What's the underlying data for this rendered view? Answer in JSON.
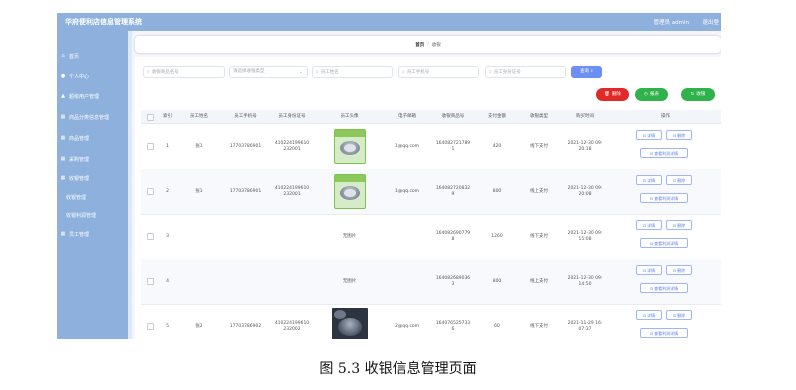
{
  "app": {
    "title": "华府便利店信息管理系统",
    "admin": "管理员 admin",
    "logout": "退出登"
  },
  "sidebar": {
    "items": [
      {
        "label": "首页",
        "icon": "home-icon"
      },
      {
        "label": "个人中心",
        "icon": "user-icon"
      },
      {
        "label": "超级用户管理",
        "icon": "user-admin-icon"
      },
      {
        "label": "商品分类信息管理",
        "icon": "grid-icon"
      },
      {
        "label": "商品管理",
        "icon": "grid-icon"
      },
      {
        "label": "采购管理",
        "icon": "grid-icon"
      },
      {
        "label": "收银管理",
        "icon": "grid-icon"
      },
      {
        "label": "收银管理",
        "sub": true
      },
      {
        "label": "收银利润管理",
        "sub": true
      },
      {
        "label": "员工管理",
        "icon": "grid-icon"
      }
    ]
  },
  "breadcrumb": {
    "home": "首页",
    "current": "收银"
  },
  "filters": {
    "order_no": "收银商品名号",
    "pay_type": "请选择收银类型",
    "emp_name": "员工姓名",
    "emp_phone": "员工手机号",
    "emp_id": "员工身份证号",
    "search": "查询"
  },
  "actions": {
    "delete": "删除",
    "report": "报表",
    "stats": "收银"
  },
  "table": {
    "headers": [
      "索引",
      "员工姓名",
      "员工手机号",
      "员工身份证号",
      "员工头像",
      "电子邮箱",
      "收银商品号",
      "支付金额",
      "收银类型",
      "购买时间",
      "操作"
    ],
    "no_image": "无图片",
    "ops": {
      "detail": "详情",
      "delete": "删除",
      "view_profit": "查看利润详情"
    },
    "rows": [
      {
        "idx": "1",
        "name": "张1",
        "phone": "17703786901",
        "idcard": "410224199610\n232001",
        "avatar": "green",
        "email": "1@qq.com",
        "order": "164082721789\n1",
        "amount": "420",
        "pay": "线下支付",
        "time": "2021-12-30 09:\n20:18"
      },
      {
        "idx": "2",
        "name": "张1",
        "phone": "17703786901",
        "idcard": "410224199610\n232001",
        "avatar": "green",
        "email": "1@qq.com",
        "order": "164082720832\n9",
        "amount": "800",
        "pay": "线上支付",
        "time": "2021-12-30 09:\n20:08"
      },
      {
        "idx": "3",
        "name": "",
        "phone": "",
        "idcard": "",
        "avatar": "none",
        "email": "",
        "order": "164082690779\n8",
        "amount": "1260",
        "pay": "线下支付",
        "time": "2021-12-30 09:\n15:08"
      },
      {
        "idx": "4",
        "name": "",
        "phone": "",
        "idcard": "",
        "avatar": "none",
        "email": "",
        "order": "164082689036\n3",
        "amount": "800",
        "pay": "线上支付",
        "time": "2021-12-30 09:\n14:50"
      },
      {
        "idx": "5",
        "name": "张2",
        "phone": "17703786902",
        "idcard": "410224199610\n232002",
        "avatar": "dark",
        "email": "2@qq.com",
        "order": "164076525733\n6",
        "amount": "60",
        "pay": "线下支付",
        "time": "2021-11-29 16:\n07:37"
      }
    ]
  },
  "caption": "图 5.3  收银信息管理页面",
  "colors": {
    "header": "#8eb0dd",
    "primary": "#6c8ef5",
    "danger": "#e02a2a",
    "success": "#2fb24a"
  }
}
